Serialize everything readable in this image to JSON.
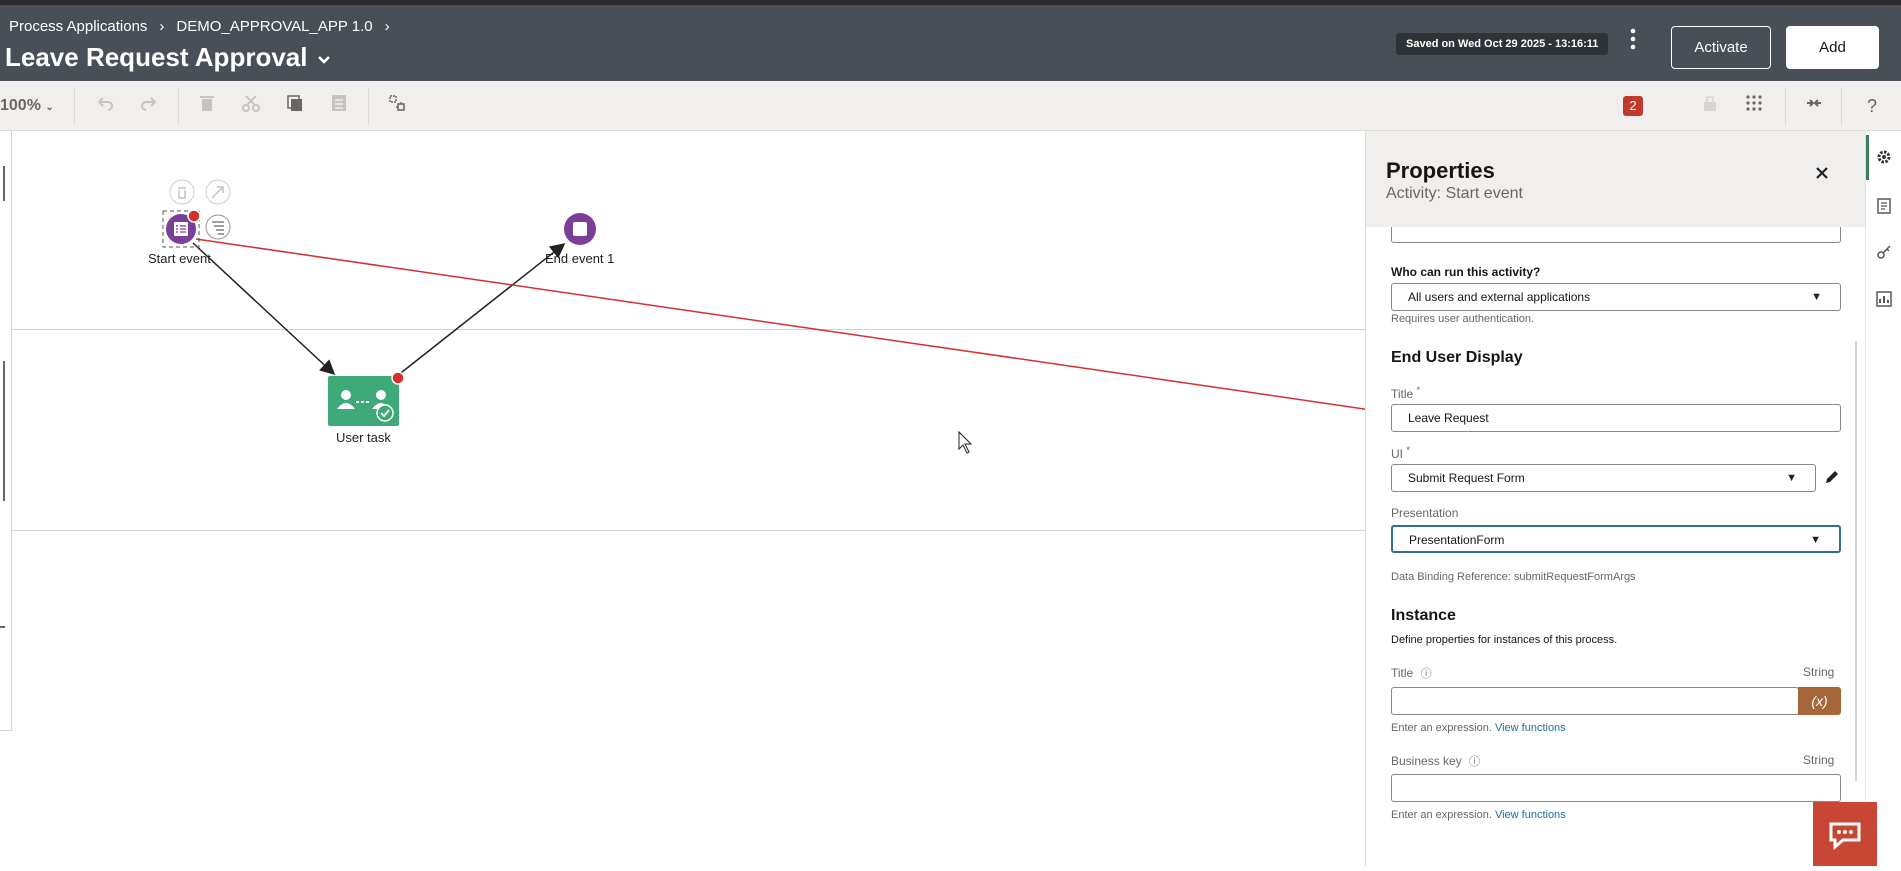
{
  "header": {
    "breadcrumb": [
      "Process Applications",
      "DEMO_APPROVAL_APP 1.0"
    ],
    "title": "Leave Request Approval",
    "saved_status": "Saved on Wed Oct 29 2025 - 13:16:11",
    "activate_label": "Activate",
    "add_label": "Add"
  },
  "toolbar": {
    "zoom": "100%",
    "issues_count": "2",
    "icons": [
      "undo-icon",
      "redo-icon",
      "delete-icon",
      "cut-icon",
      "copy-icon",
      "paste-icon",
      "layout-icon",
      "lock-icon",
      "grid-icon",
      "collapse-icon",
      "help-icon"
    ]
  },
  "canvas": {
    "nodes": {
      "start_event": "Start event",
      "end_event": "End event 1",
      "user_task": "User task"
    }
  },
  "properties": {
    "title": "Properties",
    "subtitle": "Activity: Start event",
    "who_label": "Who can run this activity?",
    "who_value": "All users and external applications",
    "who_hint": "Requires user authentication.",
    "end_user_display": "End User Display",
    "title_label": "Title",
    "title_value": "Leave Request",
    "ui_label": "UI",
    "ui_value": "Submit Request Form",
    "presentation_label": "Presentation",
    "presentation_value": "PresentationForm",
    "binding_ref": "Data Binding Reference: submitRequestFormArgs",
    "instance_heading": "Instance",
    "instance_desc": "Define properties for instances of this process.",
    "inst_title_label": "Title",
    "inst_title_type": "String",
    "expr_button": "(x)",
    "expr_hint": "Enter an expression.",
    "view_functions": "View functions",
    "business_key_label": "Business key",
    "business_key_type": "String",
    "expr_hint2": "Enter an expression.",
    "view_functions2": "View functions",
    "required_mark": "*"
  },
  "colors": {
    "header_bg": "#484f56",
    "event_purple": "#7b3f98",
    "task_green": "#3eaa7a",
    "error_red": "#d32f2f",
    "expr_button": "#a6663a",
    "chat_bg": "#c74634"
  }
}
